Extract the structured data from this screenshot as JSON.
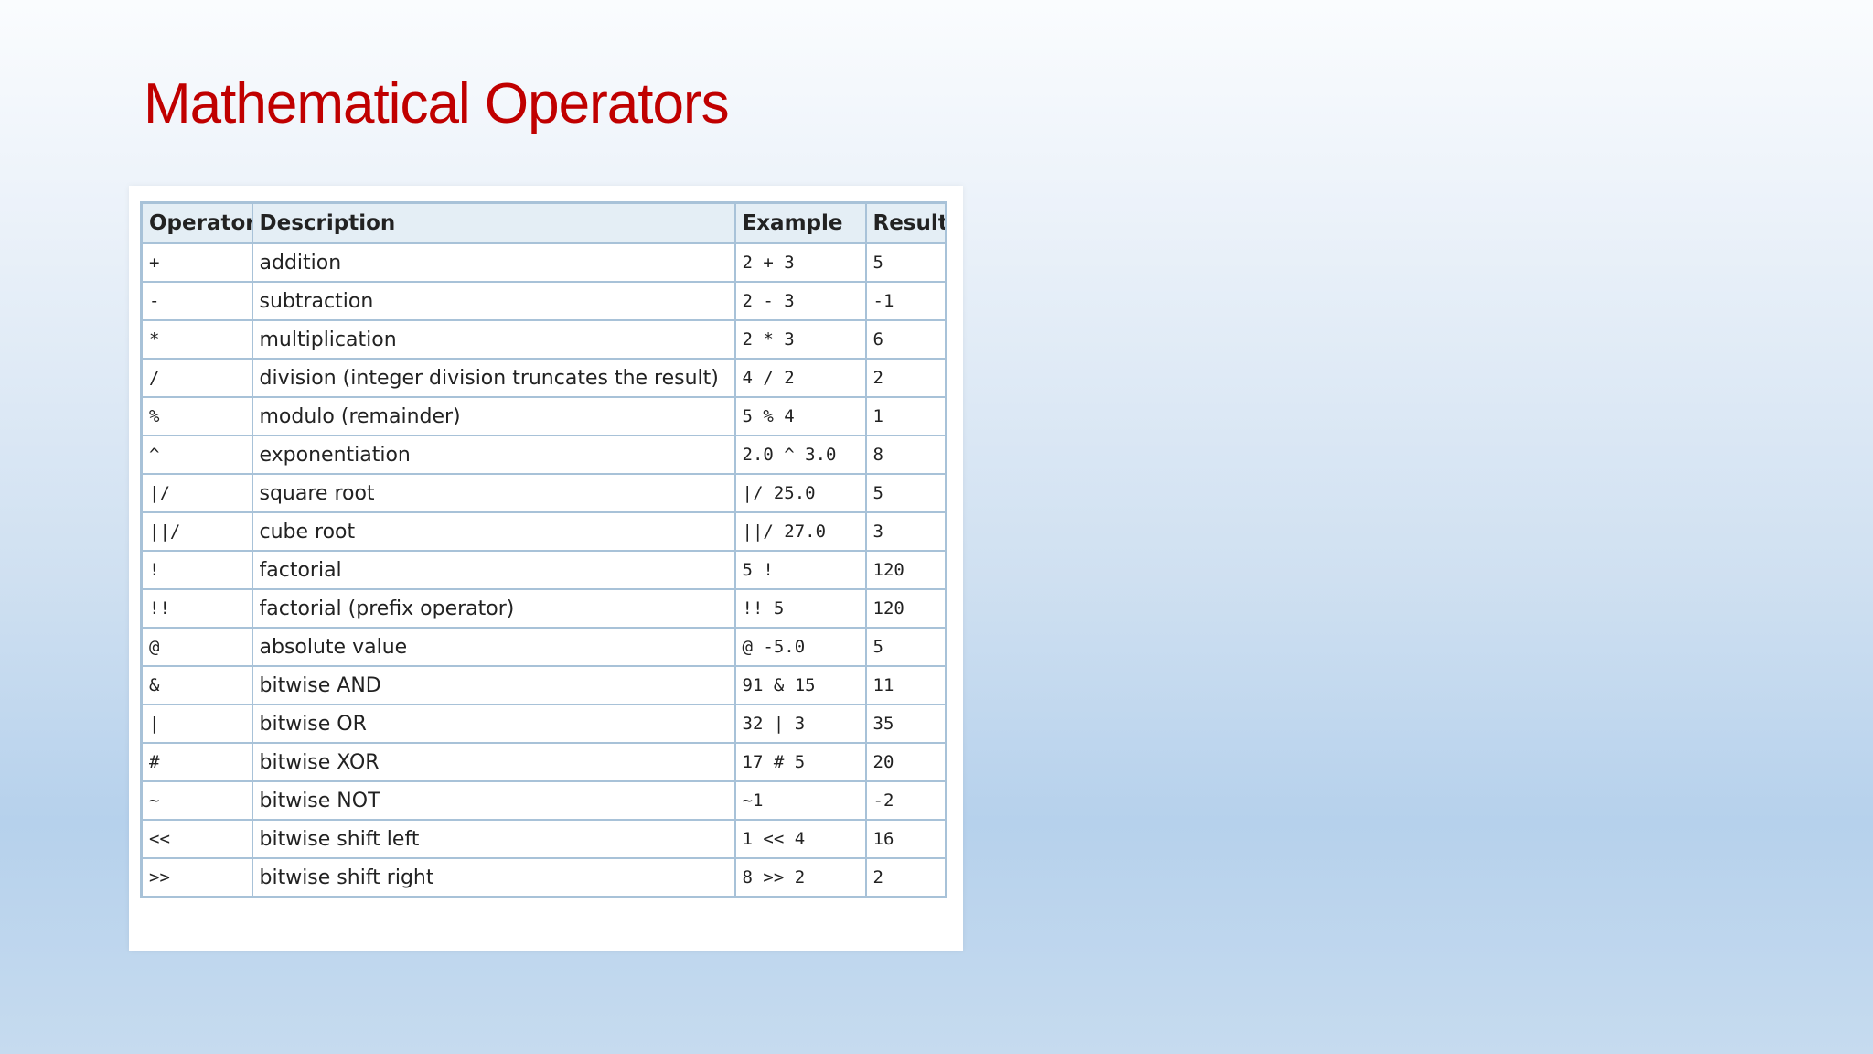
{
  "title": "Mathematical Operators",
  "table": {
    "headers": [
      "Operator",
      "Description",
      "Example",
      "Result"
    ],
    "rows": [
      {
        "operator": "+",
        "description": "addition",
        "example": "2 + 3",
        "result": "5"
      },
      {
        "operator": "-",
        "description": "subtraction",
        "example": "2 - 3",
        "result": "-1"
      },
      {
        "operator": "*",
        "description": "multiplication",
        "example": "2 * 3",
        "result": "6"
      },
      {
        "operator": "/",
        "description": "division (integer division truncates the result)",
        "example": "4 / 2",
        "result": "2"
      },
      {
        "operator": "%",
        "description": "modulo (remainder)",
        "example": "5 % 4",
        "result": "1"
      },
      {
        "operator": "^",
        "description": "exponentiation",
        "example": "2.0 ^ 3.0",
        "result": "8"
      },
      {
        "operator": "|/",
        "description": "square root",
        "example": "|/ 25.0",
        "result": "5"
      },
      {
        "operator": "||/",
        "description": "cube root",
        "example": "||/ 27.0",
        "result": "3"
      },
      {
        "operator": "!",
        "description": "factorial",
        "example": "5 !",
        "result": "120"
      },
      {
        "operator": "!!",
        "description": "factorial (prefix operator)",
        "example": "!! 5",
        "result": "120"
      },
      {
        "operator": "@",
        "description": "absolute value",
        "example": "@ -5.0",
        "result": "5"
      },
      {
        "operator": "&",
        "description": "bitwise AND",
        "example": "91 & 15",
        "result": "11"
      },
      {
        "operator": "|",
        "description": "bitwise OR",
        "example": "32 | 3",
        "result": "35"
      },
      {
        "operator": "#",
        "description": "bitwise XOR",
        "example": "17 # 5",
        "result": "20"
      },
      {
        "operator": "~",
        "description": "bitwise NOT",
        "example": "~1",
        "result": "-2"
      },
      {
        "operator": "<<",
        "description": "bitwise shift left",
        "example": "1 << 4",
        "result": "16"
      },
      {
        "operator": ">>",
        "description": "bitwise shift right",
        "example": "8 >> 2",
        "result": "2"
      }
    ]
  }
}
